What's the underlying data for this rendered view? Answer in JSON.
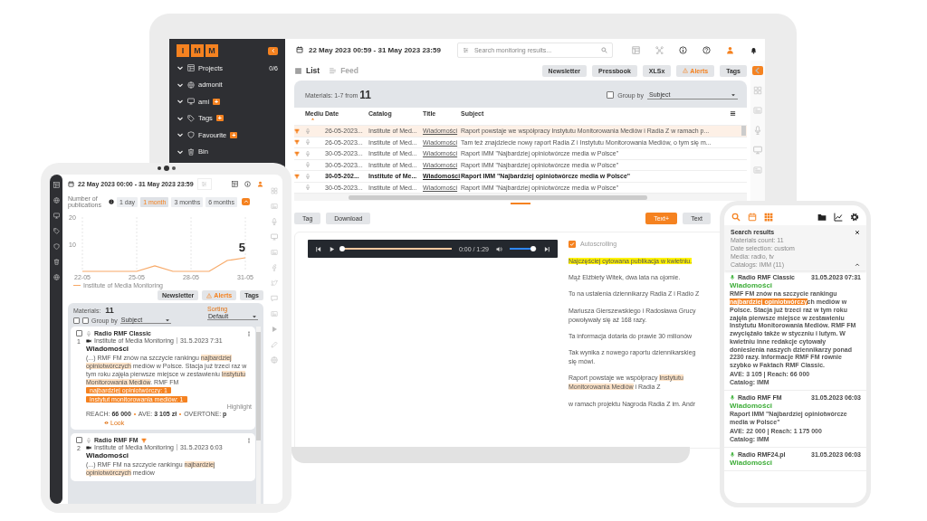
{
  "laptop": {
    "sidebar": {
      "logo": [
        "I",
        "M",
        "M"
      ],
      "items": [
        {
          "label": "Projects",
          "count": "0/6"
        },
        {
          "label": "admonit"
        },
        {
          "label": "ami",
          "badge": "+"
        },
        {
          "label": "Tags",
          "badge": "+"
        },
        {
          "label": "Favourite",
          "badge": "+"
        },
        {
          "label": "Bin"
        }
      ]
    },
    "date_range": "22 May 2023 00:59 - 31 May 2023 23:59",
    "search": {
      "placeholder": "Search monitoring results..."
    },
    "view_tabs": [
      {
        "label": "List",
        "selected": true
      },
      {
        "label": "Feed",
        "selected": false
      }
    ],
    "actions": [
      {
        "label": "Newsletter",
        "kind": "plain"
      },
      {
        "label": "Pressbook",
        "kind": "plain"
      },
      {
        "label": "XLSx",
        "kind": "plain"
      },
      {
        "label": "Alerts",
        "kind": "alert"
      },
      {
        "label": "Tags",
        "kind": "plain"
      }
    ],
    "materials": {
      "label": "Materials:",
      "range": "1-7 from",
      "count": "11"
    },
    "group_by": {
      "label": "Group by",
      "checked": false,
      "value": "Subject"
    },
    "table": {
      "columns": [
        "Mediu",
        "Date",
        "Catalog",
        "Title",
        "Subject"
      ],
      "rows": [
        {
          "trophy": true,
          "selected": true,
          "unread": false,
          "date": "26-05-2023...",
          "catalog": "Institute of Med...",
          "title": "Wiadomości",
          "subject": "Raport powstaje we współpracy Instytutu Monitorowania Mediów i Radia Z w ramach p..."
        },
        {
          "trophy": true,
          "selected": false,
          "unread": false,
          "date": "26-05-2023...",
          "catalog": "Institute of Med...",
          "title": "Wiadomości",
          "subject": "Tam też znajdziecie nowy raport Radia Z i Instytutu Monitorowania Mediów, o tym się m..."
        },
        {
          "trophy": true,
          "selected": false,
          "unread": false,
          "date": "30-05-2023...",
          "catalog": "Institute of Med...",
          "title": "Wiadomości",
          "subject": "Raport IMM \"Najbardziej opiniotwórcze media w Polsce\""
        },
        {
          "trophy": false,
          "selected": false,
          "unread": false,
          "date": "30-05-2023...",
          "catalog": "Institute of Med...",
          "title": "Wiadomości",
          "subject": "Raport IMM \"Najbardziej opiniotwórcze media w Polsce\""
        },
        {
          "trophy": true,
          "selected": false,
          "unread": true,
          "date": "30-05-202...",
          "catalog": "Institute of Me...",
          "title": "Wiadomości",
          "subject": "Raport IMM \"Najbardziej opiniotwórcze media w Polsce\""
        },
        {
          "trophy": false,
          "selected": false,
          "unread": false,
          "date": "30-05-2023...",
          "catalog": "Institute of Med...",
          "title": "Wiadomości",
          "subject": "Raport IMM \"Najbardziej opiniotwórcze media w Polsce\""
        }
      ]
    },
    "detail_actions": [
      "Tag",
      "Download"
    ],
    "text_modes": [
      {
        "label": "Text+",
        "selected": true
      },
      {
        "label": "Text",
        "selected": false
      }
    ],
    "player": {
      "time": "0:00 / 1:29",
      "progress": {
        "level": 0
      },
      "volume": {
        "level": 0.85
      }
    },
    "autoscrolling": {
      "label": "Autoscrolling",
      "checked": true
    },
    "transcript": [
      {
        "lines": [
          [
            {
              "text": "Najczęściej cytowana publikacja w kwietniu.",
              "color": "#fff200"
            }
          ]
        ]
      },
      {
        "lines": [
          [
            {
              "text": "Mąż Elżbiety Witek, dwa lata na ojomie."
            }
          ]
        ]
      },
      {
        "lines": [
          [
            {
              "text": "To na ustalenia dziennikarzy Radia Z i Radio Z"
            }
          ]
        ]
      },
      {
        "lines": [
          [
            {
              "text": "Mariusza Gierszewskiego i Radosława Grucy"
            }
          ],
          [
            {
              "text": "powoływały się aż 168 razy."
            }
          ]
        ]
      },
      {
        "lines": [
          [
            {
              "text": "Ta informacja dotarła do prawie 30 milionów"
            }
          ]
        ]
      },
      {
        "lines": [
          [
            {
              "text": "Tak wynika z nowego raportu dziennikarskieg"
            }
          ],
          [
            {
              "text": "się mówi."
            }
          ]
        ]
      },
      {
        "lines": [
          [
            {
              "text": "Raport powstaje we współpracy "
            },
            {
              "text": "Instytutu",
              "color": "#fde3c8"
            }
          ],
          [
            {
              "text": "Monitorowania Mediów",
              "color": "#fde3c8"
            },
            {
              "text": " i Radia Z"
            }
          ]
        ]
      },
      {
        "lines": [
          [
            {
              "text": "w ramach projektu Nagroda Radia Z im. Andr"
            }
          ]
        ]
      }
    ]
  },
  "tablet": {
    "date_range": "22 May 2023 00:00 - 31 May 2023 23:59",
    "periods": [
      {
        "label": "1 day",
        "selected": false
      },
      {
        "label": "1 month",
        "selected": true
      },
      {
        "label": "3 months",
        "selected": false
      },
      {
        "label": "6 months",
        "selected": false
      }
    ],
    "chart_data": {
      "type": "line",
      "ylabel": "Number of publications",
      "categories": [
        "22-05",
        null,
        null,
        "25-05",
        null,
        null,
        "28-05",
        null,
        null,
        "31-05"
      ],
      "ylim": [
        0,
        20
      ],
      "yticks": [
        10,
        20
      ],
      "grid": true,
      "series": [
        {
          "name": "Institute of Media Monitoring",
          "color": "#f7a866",
          "values": [
            0,
            0,
            0,
            0,
            2,
            0,
            0,
            0,
            4,
            5
          ]
        }
      ],
      "annotations": [
        {
          "x": "31-05",
          "y": 5,
          "text": "5"
        }
      ]
    },
    "actions": [
      {
        "label": "Newsletter",
        "kind": "plain"
      },
      {
        "label": "Alerts",
        "kind": "alert"
      },
      {
        "label": "Tags",
        "kind": "plain"
      }
    ],
    "materials": {
      "label": "Materials:",
      "count": "11"
    },
    "select_all": {
      "checked": false
    },
    "group_by": {
      "label": "Group by",
      "checked": false,
      "value": "Subject"
    },
    "sorting": {
      "label": "Sorting",
      "value": "Default"
    },
    "cards": [
      {
        "number": "1",
        "checked": false,
        "station": "Radio RMF Classic",
        "trophy": false,
        "source": "Institute of Media Monitoring",
        "date": "31.5.2023 7:31",
        "title": "Wiadomości",
        "snippet": [
          {
            "text": "(...) RMF FM znów na szczycie rankingu "
          },
          {
            "text": "najbardziej opiniotwórczych",
            "color": "#fde3c8"
          },
          {
            "text": " mediów w Polsce. Stacja już trzeci raz w tym roku zajęła pierwsze miejsce w zestawieniu "
          },
          {
            "text": "Instytutu Monitorowania Mediów",
            "color": "#fde3c8"
          },
          {
            "text": ". RMF FM"
          }
        ],
        "tags": [
          "najbardziej opiniotwórczy: 1",
          "instytut monitorowania mediów: 1"
        ],
        "highlight_label": "Highlight",
        "stats": [
          {
            "label": "REACH:",
            "value": "66 000"
          },
          {
            "label": "AVE:",
            "value": "3 105 zł"
          },
          {
            "label": "OVERTONE:",
            "value": "p"
          }
        ],
        "look": "Look"
      },
      {
        "number": "2",
        "checked": false,
        "station": "Radio RMF FM",
        "trophy": true,
        "source": "Institute of Media Monitoring",
        "date": "31.5.2023 6:03",
        "title": "Wiadomości",
        "snippet": [
          {
            "text": "(...) RMF FM na szczycie rankingu "
          },
          {
            "text": "najbardziej opiniotwórczych",
            "color": "#fde3c8"
          },
          {
            "text": " mediów"
          }
        ]
      }
    ]
  },
  "phone": {
    "search_results": {
      "title": "Search results",
      "lines": [
        "Materials count: 11",
        "Date selection: custom",
        "Media: radio, tv",
        "Catalogs: IMM (11)"
      ]
    },
    "results": [
      {
        "station": "Radio RMF Classic",
        "date": "31.05.2023 07:31",
        "title": "Wiadomości",
        "body": [
          {
            "text": "RMF FM znów na szczycie rankingu "
          },
          {
            "text": "najbardziej opiniotwórczy",
            "color": "#f58220"
          },
          {
            "text": "ch mediów w Polsce. Stacja już trzeci raz w tym roku zajęła pierwsze miejsce w zestawieniu Instytutu Monitorowania Mediów. RMF FM zwyciężało także w styczniu i lutym. W kwietniu inne redakcje cytowały doniesienia naszych dziennikarzy ponad 2230 razy. Informacje RMF FM równie szybko w Faktach RMF Classic."
          }
        ],
        "meta": [
          "AVE: 3 105 | Reach: 66 000",
          "Catalog: IMM"
        ]
      },
      {
        "station": "Radio RMF FM",
        "date": "31.05.2023 06:03",
        "title": "Wiadomości",
        "body": [
          {
            "text": "Raport IMM \"Najbardziej opiniotwórcze media w Polsce\""
          }
        ],
        "meta": [
          "AVE: 22 000 | Reach: 1 175 000",
          "Catalog: IMM"
        ]
      },
      {
        "station": "Radio RMF24.pl",
        "date": "31.05.2023 06:03",
        "title": "Wiadomości"
      }
    ]
  }
}
